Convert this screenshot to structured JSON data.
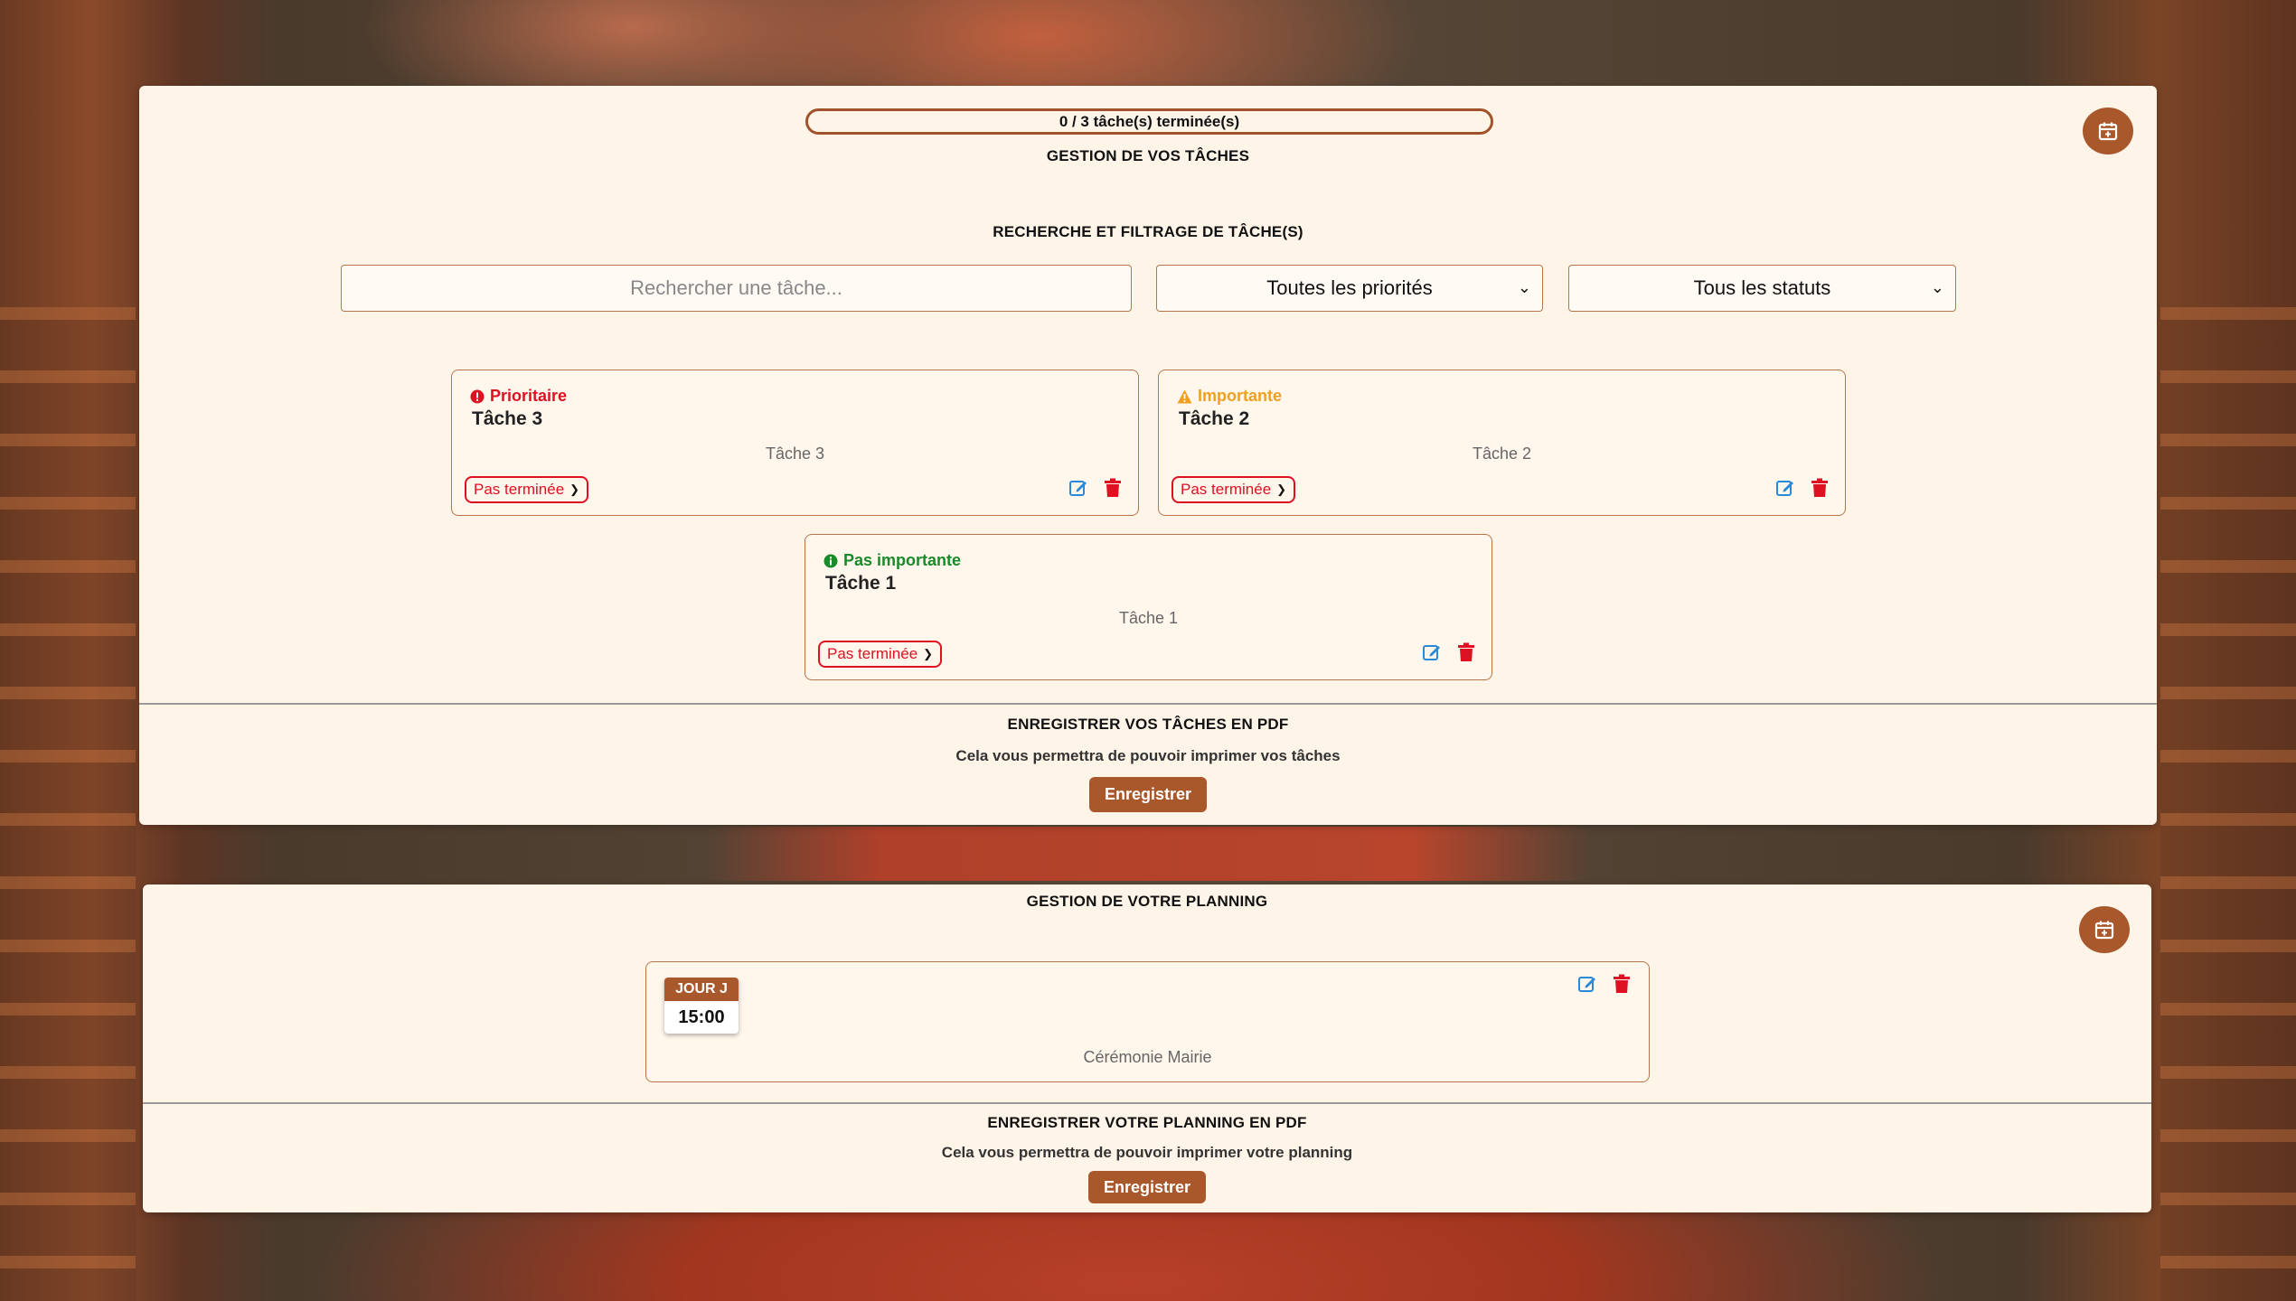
{
  "progress": {
    "text": "0 / 3 tâche(s) terminée(s)",
    "completed": 0,
    "total": 3
  },
  "tasks_section": {
    "title": "GESTION DE VOS TÂCHES",
    "search_title": "RECHERCHE ET FILTRAGE DE TÂCHE(S)",
    "search_placeholder": "Rechercher une tâche...",
    "priority_filter": {
      "selected": "Toutes les priorités"
    },
    "status_filter": {
      "selected": "Tous les statuts"
    },
    "tasks": [
      {
        "priority": "Prioritaire",
        "priority_color": "#dd1122",
        "priority_icon": "exclamation-circle-icon",
        "title": "Tâche 3",
        "description": "Tâche 3",
        "status": "Pas terminée"
      },
      {
        "priority": "Importante",
        "priority_color": "#f0a020",
        "priority_icon": "warning-triangle-icon",
        "title": "Tâche 2",
        "description": "Tâche 2",
        "status": "Pas terminée"
      },
      {
        "priority": "Pas importante",
        "priority_color": "#1a8a2a",
        "priority_icon": "info-circle-icon",
        "title": "Tâche 1",
        "description": "Tâche 1",
        "status": "Pas terminée"
      }
    ],
    "pdf": {
      "title": "ENREGISTRER VOS TÂCHES EN PDF",
      "subtitle": "Cela vous permettra de pouvoir imprimer vos tâches",
      "button": "Enregistrer"
    }
  },
  "planning_section": {
    "title": "GESTION DE VOTRE PLANNING",
    "events": [
      {
        "day": "JOUR J",
        "time": "15:00",
        "description": "Cérémonie Mairie"
      }
    ],
    "pdf": {
      "title": "ENREGISTRER VOTRE PLANNING EN PDF",
      "subtitle": "Cela vous permettra de pouvoir imprimer votre planning",
      "button": "Enregistrer"
    }
  },
  "colors": {
    "accent": "#a9582c",
    "panel_bg": "#fff4e8",
    "edit_icon": "#2a8ad8",
    "delete_icon": "#dd1122"
  }
}
